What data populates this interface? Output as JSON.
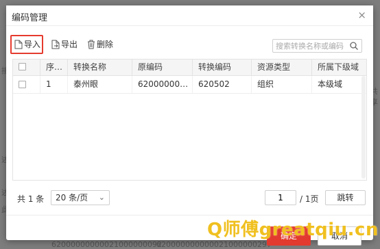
{
  "background": {
    "left_fragments": [
      "接",
      "述",
      "述",
      "此"
    ],
    "right_fragments": [
      "共享"
    ],
    "bottom_codes": [
      "62000000000021000000092",
      "620000000000021000000297"
    ]
  },
  "dialog": {
    "title": "编码管理",
    "close_glyph": "×"
  },
  "toolbar": {
    "import_label": "导入",
    "export_label": "导出",
    "delete_label": "删除",
    "search_placeholder": "搜索转换名称或编码"
  },
  "table": {
    "columns": [
      "序…",
      "转换名称",
      "原编码",
      "转换编码",
      "资源类型",
      "所属下级域"
    ],
    "rows": [
      {
        "index": "1",
        "name": "泰州眼",
        "source_code": "62000000…",
        "target_code": "620502",
        "resource_type": "组织",
        "domain": "本级域"
      }
    ]
  },
  "pager": {
    "total_text": "共 1 条",
    "page_size": "20 条/页",
    "current_page": "1",
    "total_pages": "/ 1页",
    "jump_label": "跳转"
  },
  "footer": {
    "ok_label": "确定",
    "cancel_label": "取消"
  },
  "watermark": "Q师傅greatqiu.cn",
  "colors": {
    "accent": "#e23a2e",
    "highlight_border": "#e53a2e",
    "watermark": "#f0c020"
  }
}
